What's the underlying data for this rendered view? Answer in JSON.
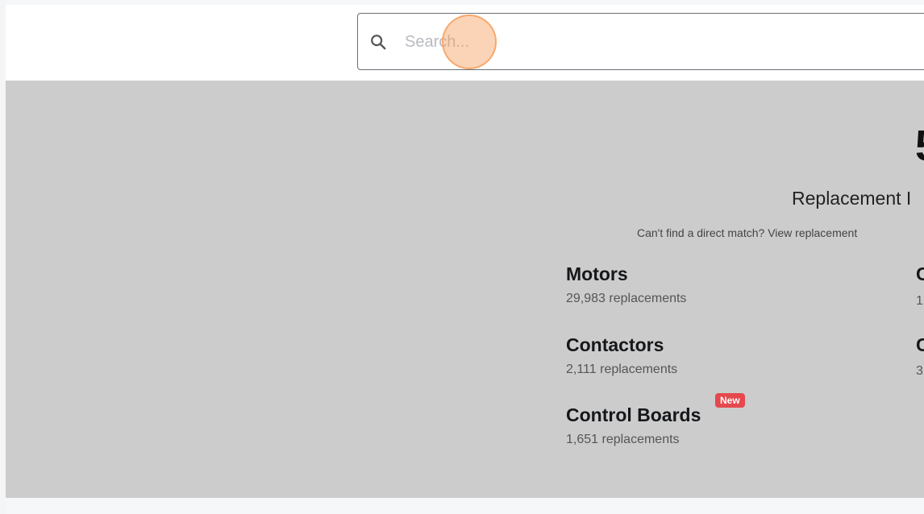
{
  "search": {
    "placeholder": "Search..."
  },
  "hero": {
    "big_text": "5",
    "title": "Replacement I",
    "subtitle": "Can't find a direct match? View replacement"
  },
  "categories": [
    {
      "name": "Motors",
      "count": "29,983 replacements"
    },
    {
      "name": "Contactors",
      "count": "2,111 replacements"
    },
    {
      "name": "Control Boards",
      "count": "1,651 replacements",
      "badge": "New"
    }
  ],
  "right_column_peek": [
    {
      "name": "C",
      "count": "1"
    },
    {
      "name": "C",
      "count": "3"
    }
  ],
  "colors": {
    "hero_background": "#cccccc",
    "badge": "#e5484d",
    "click_marker": "#f7a05f"
  }
}
